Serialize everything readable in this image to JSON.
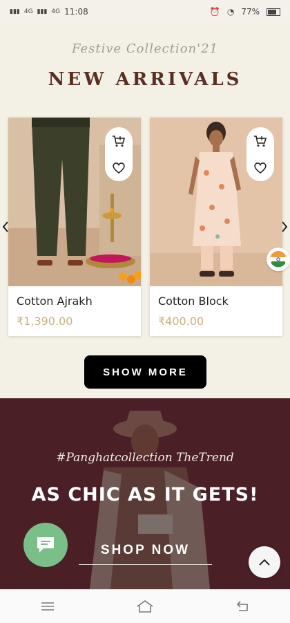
{
  "status": {
    "time": "11:08",
    "battery": "77%",
    "signal_left_1": "4G",
    "signal_left_2": "4G"
  },
  "collection": {
    "tagline": "Festive Collection'21",
    "title": "NEW ARRIVALS"
  },
  "products": [
    {
      "name": "Cotton Ajrakh",
      "price": "₹1,390.00"
    },
    {
      "name": "Cotton Block",
      "price": "₹400.00"
    }
  ],
  "show_more_label": "SHOW MORE",
  "banner": {
    "tag": "#Panghatcollection TheTrend",
    "heading": "AS CHIC AS IT GETS!",
    "cta": "SHOP NOW"
  },
  "colors": {
    "accent_price": "#c9b07a",
    "title": "#5a2f22",
    "banner_bg": "#4a1f26",
    "chat_button": "#7bbf88"
  },
  "icons": {
    "cart": "cart-icon",
    "wishlist": "heart-icon",
    "carousel_prev": "chevron-left-icon",
    "carousel_next": "chevron-right-icon",
    "chat": "chat-icon",
    "scroll_top": "chevron-up-icon",
    "nav_menu": "menu-icon",
    "nav_home": "home-icon",
    "nav_back": "back-icon"
  }
}
